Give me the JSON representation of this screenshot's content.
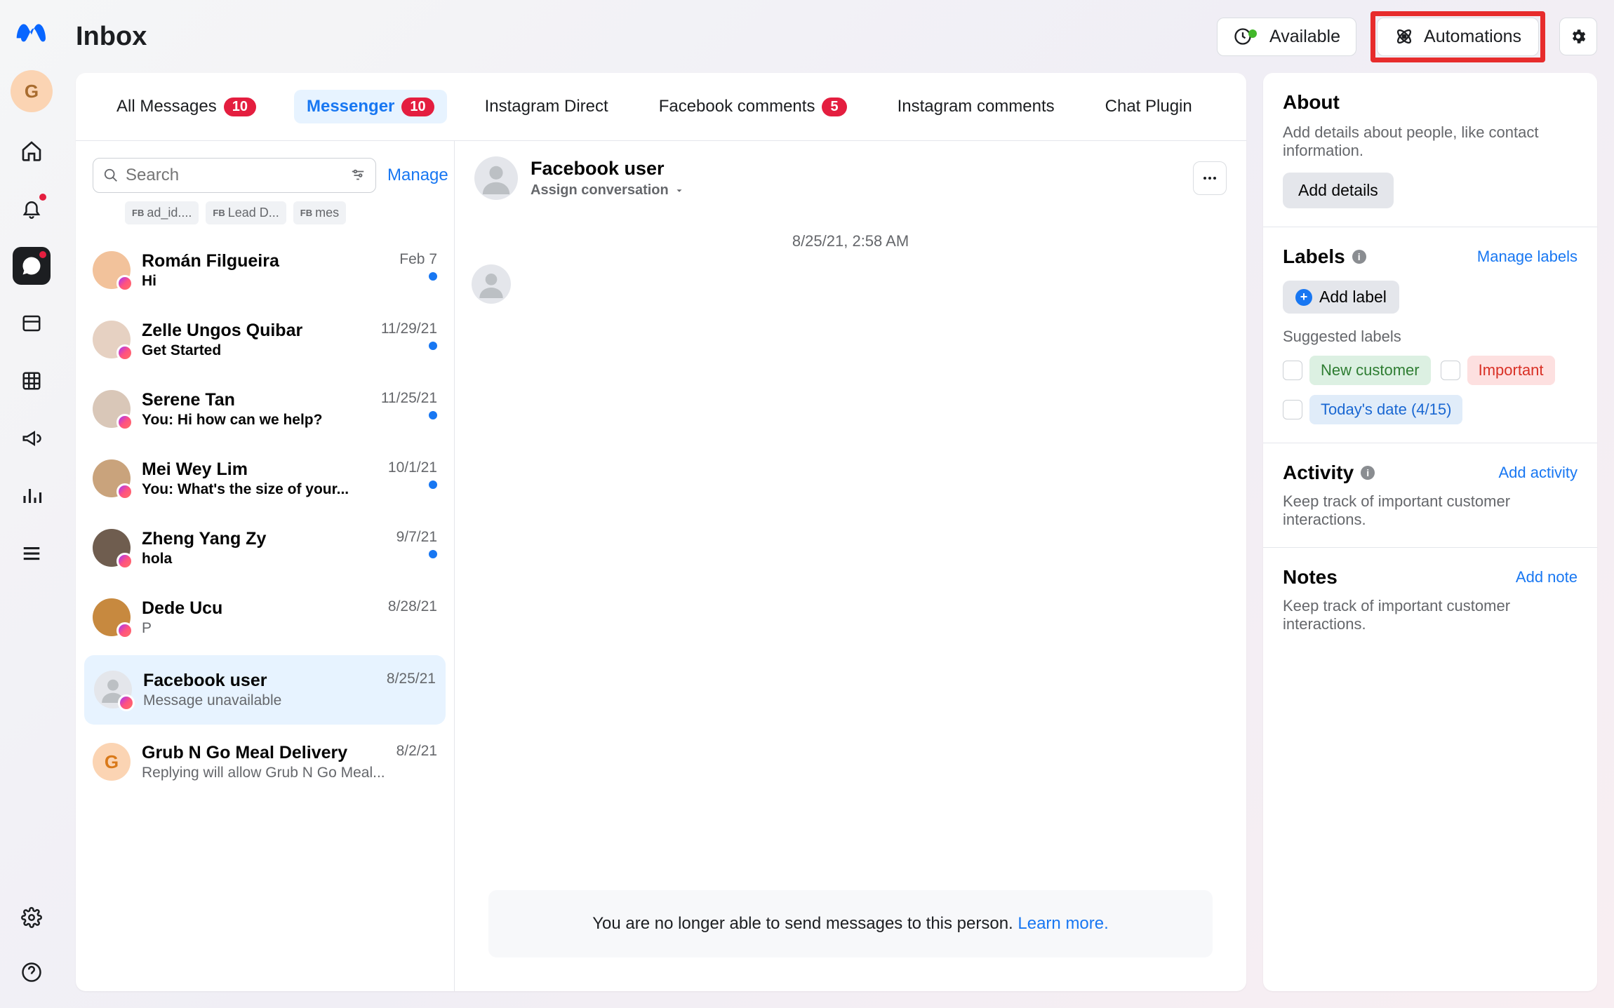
{
  "page": {
    "title": "Inbox"
  },
  "rail": {
    "avatar_letter": "G"
  },
  "header": {
    "available_label": "Available",
    "automations_label": "Automations"
  },
  "tabs": [
    {
      "label": "All Messages",
      "badge": "10",
      "active": false
    },
    {
      "label": "Messenger",
      "badge": "10",
      "active": true
    },
    {
      "label": "Instagram Direct",
      "badge": "",
      "active": false
    },
    {
      "label": "Facebook comments",
      "badge": "5",
      "active": false
    },
    {
      "label": "Instagram comments",
      "badge": "",
      "active": false
    },
    {
      "label": "Chat Plugin",
      "badge": "",
      "active": false
    }
  ],
  "search": {
    "placeholder": "Search",
    "manage_label": "Manage"
  },
  "chips": [
    {
      "prefix": "FB",
      "text": "ad_id...."
    },
    {
      "prefix": "FB",
      "text": "Lead D..."
    },
    {
      "prefix": "FB",
      "text": "mes"
    }
  ],
  "threads": [
    {
      "name": "Román Filgueira",
      "preview": "Hi",
      "date": "Feb 7",
      "unread": true,
      "avatarBg": "#f2c29b"
    },
    {
      "name": "Zelle Ungos Quibar",
      "preview": "Get Started",
      "date": "11/29/21",
      "unread": true,
      "avatarBg": "#e6d1c2"
    },
    {
      "name": "Serene Tan",
      "preview": "You: Hi how can we help?",
      "date": "11/25/21",
      "unread": true,
      "avatarBg": "#d9c7b8"
    },
    {
      "name": "Mei Wey Lim",
      "preview": "You: What's the size of your...",
      "date": "10/1/21",
      "unread": true,
      "avatarBg": "#c9a37c"
    },
    {
      "name": "Zheng Yang Zy",
      "preview": "hola",
      "date": "9/7/21",
      "unread": true,
      "avatarBg": "#6f5d4f"
    },
    {
      "name": "Dede Ucu",
      "preview": "P",
      "date": "8/28/21",
      "unread": false,
      "read": true,
      "avatarBg": "#c7893f"
    },
    {
      "name": "Facebook user",
      "preview": "Message unavailable",
      "date": "8/25/21",
      "unread": false,
      "read": true,
      "selected": true,
      "silhouette": true
    },
    {
      "name": "Grub N Go Meal Delivery",
      "preview": "Replying will allow Grub N Go Meal...",
      "date": "8/2/21",
      "unread": false,
      "read": true,
      "letter": "G"
    }
  ],
  "conversation": {
    "title": "Facebook user",
    "assign_label": "Assign conversation",
    "timestamp": "8/25/21, 2:58 AM",
    "blocked_text": "You are no longer able to send messages to this person. ",
    "learn_more": "Learn more."
  },
  "about": {
    "title": "About",
    "subtitle": "Add details about people, like contact information.",
    "button": "Add details"
  },
  "labels": {
    "title": "Labels",
    "manage_link": "Manage labels",
    "add_label": "Add label",
    "suggested_title": "Suggested labels",
    "suggested": [
      {
        "text": "New customer",
        "cls": "green"
      },
      {
        "text": "Important",
        "cls": "red"
      },
      {
        "text": "Today's date (4/15)",
        "cls": "blue"
      }
    ]
  },
  "activity": {
    "title": "Activity",
    "link": "Add activity",
    "subtitle": "Keep track of important customer interactions."
  },
  "notes": {
    "title": "Notes",
    "link": "Add note",
    "subtitle": "Keep track of important customer interactions."
  }
}
